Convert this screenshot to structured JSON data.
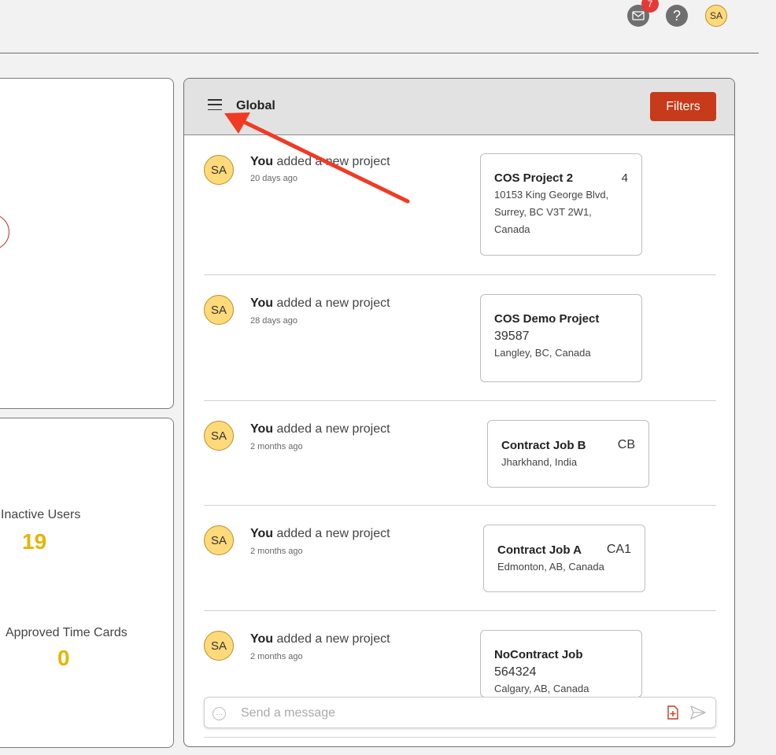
{
  "topbar": {
    "mail_badge": "7",
    "help_glyph": "?",
    "user_initials": "SA"
  },
  "stats": {
    "inactive_users_label": "Inactive Users",
    "inactive_users_value": "19",
    "approved_time_cards_label": "Approved Time Cards",
    "approved_time_cards_value": "0"
  },
  "feed": {
    "title": "Global",
    "filters_label": "Filters",
    "entries": [
      {
        "initials": "SA",
        "actor": "You",
        "action": " added a new project",
        "time": "20 days ago",
        "project": {
          "name": "COS Project 2",
          "code": "4",
          "address": [
            "10153 King George Blvd,",
            "Surrey, BC V3T 2W1,",
            "Canada"
          ]
        }
      },
      {
        "initials": "SA",
        "actor": "You",
        "action": " added a new project",
        "time": "28 days ago",
        "project": {
          "name": "COS Demo Project",
          "code": "39587",
          "address": [
            "Langley, BC, Canada"
          ]
        }
      },
      {
        "initials": "SA",
        "actor": "You",
        "action": " added a new project",
        "time": "2 months ago",
        "project": {
          "name": "Contract Job B",
          "code": "CB",
          "address": [
            "Jharkhand, India"
          ]
        }
      },
      {
        "initials": "SA",
        "actor": "You",
        "action": " added a new project",
        "time": "2 months ago",
        "project": {
          "name": "Contract Job A",
          "code": "CA1",
          "address": [
            "Edmonton, AB, Canada"
          ]
        }
      },
      {
        "initials": "SA",
        "actor": "You",
        "action": " added a new project",
        "time": "2 months ago",
        "project": {
          "name": "NoContract Job",
          "code": "564324",
          "address": [
            "Calgary, AB, Canada"
          ]
        }
      }
    ],
    "message_placeholder": "Send a message"
  },
  "colors": {
    "accent": "#c73a1a",
    "stat_value": "#e8b400",
    "avatar_bg": "#ffd97a",
    "annotation_arrow": "#f03a24"
  }
}
